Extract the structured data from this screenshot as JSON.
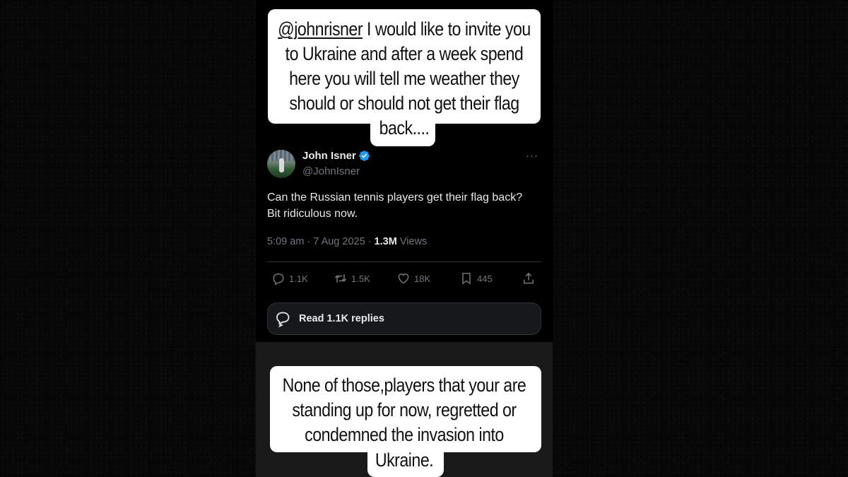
{
  "story": {
    "top_caption": {
      "mention": "@johnrisner",
      "line1_rest": " I would like to invite you",
      "line2": "to Ukraine and after a week spend",
      "line3": "here you will tell me weather they",
      "line4": "should or should not get their flag",
      "line5": "back...."
    },
    "bottom_caption": {
      "line1": "None of those,players that your are",
      "line2": "standing up for now, regretted or",
      "line3": "condemned the invasion into",
      "line4": "Ukraine."
    }
  },
  "tweet": {
    "author_name": "John Isner",
    "author_handle": "@JohnIsner",
    "verified": true,
    "more_label": "···",
    "text": "Can the Russian tennis players get their flag back? Bit ridiculous now.",
    "timestamp": "5:09 am · 7 Aug 2025 · ",
    "views_count": "1.3M",
    "views_label": " Views",
    "actions": {
      "replies": "1.1K",
      "reposts": "1.5K",
      "likes": "18K",
      "bookmarks": "445"
    },
    "read_replies_label": "Read 1.1K replies"
  },
  "colors": {
    "background": "#000000",
    "text_primary": "#e7e9ea",
    "text_secondary": "#71767b",
    "verified_blue": "#1d9bf0",
    "caption_bg": "#ffffff"
  },
  "icons": [
    "verified-badge-icon",
    "more-icon",
    "reply-icon",
    "repost-icon",
    "like-icon",
    "bookmark-icon",
    "share-icon",
    "chat-bubbles-icon"
  ]
}
